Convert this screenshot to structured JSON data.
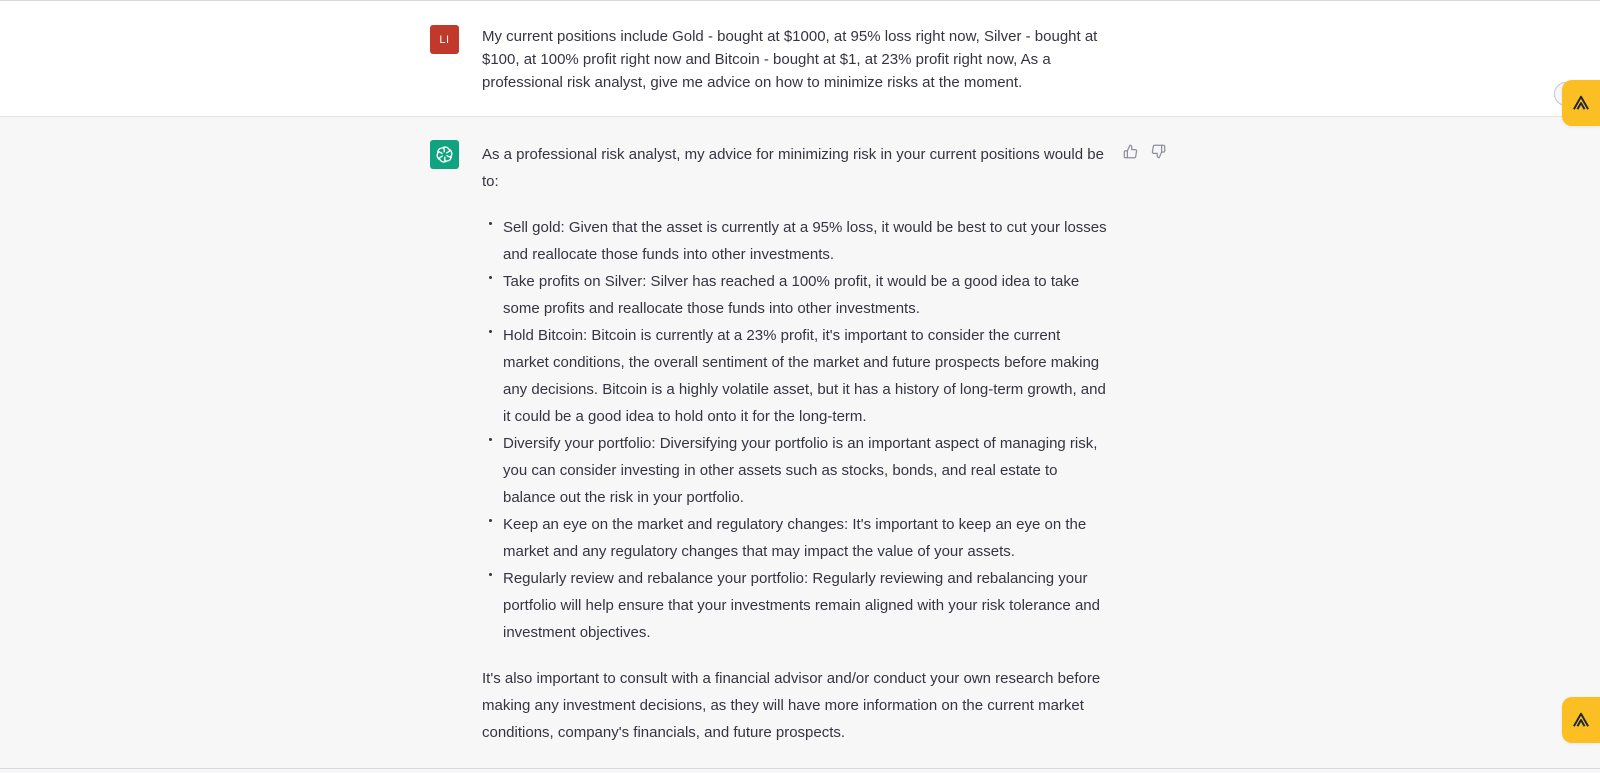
{
  "user_message": {
    "avatar_initials": "LI",
    "text": "My current positions include Gold - bought at $1000, at 95% loss right now, Silver - bought at $100, at 100% profit right now and Bitcoin - bought at $1, at 23% profit right now, As a professional risk analyst, give me advice on how to minimize risks at the moment."
  },
  "assistant_message": {
    "intro": "As a professional risk analyst, my advice for minimizing risk in your current positions would be to:",
    "items": [
      "Sell gold: Given that the asset is currently at a 95% loss, it would be best to cut your losses and reallocate those funds into other investments.",
      "Take profits on Silver: Silver has reached a 100% profit, it would be a good idea to take some profits and reallocate those funds into other investments.",
      "Hold Bitcoin: Bitcoin is currently at a 23% profit, it's important to consider the current market conditions, the overall sentiment of the market and future prospects before making any decisions. Bitcoin is a highly volatile asset, but it has a history of long-term growth, and it could be a good idea to hold onto it for the long-term.",
      "Diversify your portfolio: Diversifying your portfolio is an important aspect of managing risk, you can consider investing in other assets such as stocks, bonds, and real estate to balance out the risk in your portfolio.",
      "Keep an eye on the market and regulatory changes: It's important to keep an eye on the market and any regulatory changes that may impact the value of your assets.",
      "Regularly review and rebalance your portfolio: Regularly reviewing and rebalancing your portfolio will help ensure that your investments remain aligned with your risk tolerance and investment objectives."
    ],
    "outro": "It's also important to consult with a financial advisor and/or conduct your own research before making any investment decisions, as they will have more information on the current market conditions, company's financials, and future prospects."
  },
  "icons": {
    "user_avatar": "user-avatar",
    "assistant_avatar": "openai-logo-icon",
    "thumbs_up": "thumbs-up-icon",
    "thumbs_down": "thumbs-down-icon",
    "scroll_down": "arrow-down-circle-icon",
    "extension": "extension-logo-icon"
  },
  "colors": {
    "user_avatar_bg": "#c0392b",
    "assistant_avatar_bg": "#10a37f",
    "extension_bg": "#fbbf24",
    "assistant_row_bg": "#f7f7f8",
    "user_row_bg": "#ffffff"
  }
}
